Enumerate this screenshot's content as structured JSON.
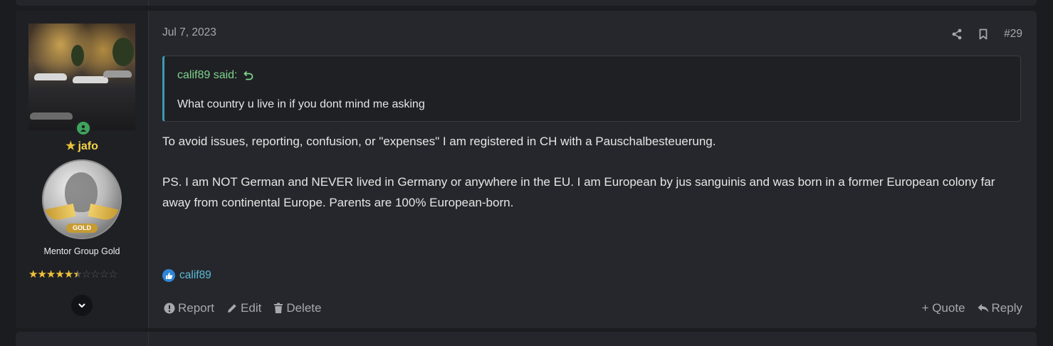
{
  "post": {
    "date": "Jul 7, 2023",
    "number": "#29",
    "author": {
      "name": "jafo",
      "title": "Mentor Group Gold",
      "badge_text": "GOLD",
      "rating": {
        "value": 5.5,
        "max": 10
      }
    },
    "quote": {
      "author": "calif89 said:",
      "text": "What country u live in if you dont mind me asking"
    },
    "body": [
      "To avoid issues, reporting, confusion, or \"expenses\" I am registered in CH with a Pauschalbesteuerung.",
      "PS. I am NOT German and NEVER lived in Germany or anywhere in the EU. I am European by jus sanguinis and was born in a former European colony far away from continental Europe. Parents are 100% European-born."
    ],
    "reactions": {
      "users": "calif89",
      "icon": "like-icon"
    },
    "actions_left": {
      "report": "Report",
      "edit": "Edit",
      "delete": "Delete"
    },
    "actions_right": {
      "quote": "+ Quote",
      "reply": "Reply"
    }
  },
  "colors": {
    "accent_username": "#f3d34a",
    "quote_author": "#7ed38c",
    "link": "#58bcd8",
    "quote_border": "#3c9bb3"
  }
}
